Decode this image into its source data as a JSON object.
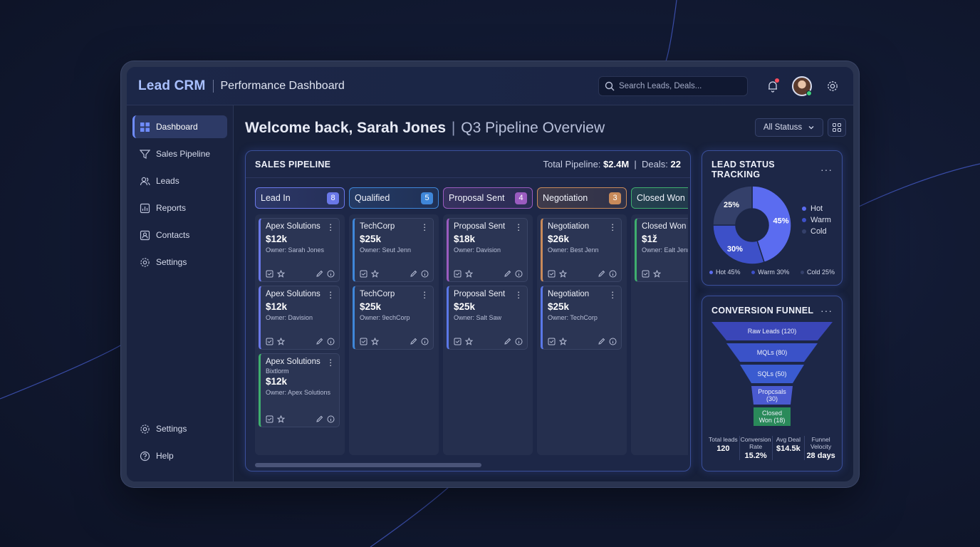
{
  "app": {
    "brand": "Lead CRM",
    "subtitle": "Performance Dashboard"
  },
  "search": {
    "placeholder": "Search Leads, Deals..."
  },
  "sidebar": {
    "items": [
      {
        "label": "Dashboard",
        "icon": "dashboard-icon",
        "active": true
      },
      {
        "label": "Sales Pipeline",
        "icon": "filter-icon"
      },
      {
        "label": "Leads",
        "icon": "users-icon"
      },
      {
        "label": "Reports",
        "icon": "report-icon"
      },
      {
        "label": "Contacts",
        "icon": "contacts-icon"
      },
      {
        "label": "Settings",
        "icon": "gear-icon"
      }
    ],
    "bottom": [
      {
        "label": "Settings",
        "icon": "gear-icon"
      },
      {
        "label": "Help",
        "icon": "help-icon"
      }
    ]
  },
  "header": {
    "welcome": "Welcome back, Sarah Jones",
    "separator": "|",
    "overview": "Q3 Pipeline Overview",
    "status_filter": "All Statuss"
  },
  "pipeline": {
    "title": "SALES PIPELINE",
    "total_label": "Total Pipeline:",
    "total_value": "$2.4M",
    "divider": "|",
    "deals_label": "Deals:",
    "deals_value": "22",
    "columns": [
      {
        "name": "Lead In",
        "count": "8",
        "color": "#6a78e8",
        "cards": [
          {
            "title": "Apex Solutions",
            "amount": "$12k",
            "owner": "Owner: Sarah Jones"
          },
          {
            "title": "Apex Solutions",
            "amount": "$12k",
            "owner": "Owner: Davision"
          },
          {
            "title": "Apex Solutions",
            "sub": "Bixtlorm",
            "amount": "$12k",
            "owner": "Owner: Apex Solutions",
            "accent": "#3fae6e"
          }
        ]
      },
      {
        "name": "Qualified",
        "count": "5",
        "color": "#3f86d8",
        "cards": [
          {
            "title": "TechCorp",
            "amount": "$25k",
            "owner": "Owner: Seut Jenn"
          },
          {
            "title": "TechCorp",
            "amount": "$25k",
            "owner": "Owner: 9echCorp"
          }
        ]
      },
      {
        "name": "Proposal Sent",
        "count": "4",
        "color": "#9a5bbf",
        "cards": [
          {
            "title": "Proposal Sent",
            "amount": "$18k",
            "owner": "Owner: Davision"
          },
          {
            "title": "Proposal Sent",
            "amount": "$25k",
            "owner": "Owner: Salt Saw",
            "accent": "#5a78e8"
          }
        ]
      },
      {
        "name": "Negotiation",
        "count": "3",
        "color": "#c88a5a",
        "cards": [
          {
            "title": "Negotiation",
            "amount": "$26k",
            "owner": "Owner: Best Jenn"
          },
          {
            "title": "Negotiation",
            "amount": "$25k",
            "owner": "Owner: TechCorp",
            "accent": "#5a78e8"
          }
        ]
      },
      {
        "name": "Closed Won",
        "count": "",
        "color": "#3fae6e",
        "cards": [
          {
            "title": "Closed Won",
            "amount": "$1ž",
            "owner": "Owner: Ealt Jenn"
          }
        ]
      }
    ]
  },
  "lead_status": {
    "title": "LEAD STATUS TRACKING",
    "more": "···",
    "legend": [
      {
        "label": "Hot",
        "color": "#5b6cf0"
      },
      {
        "label": "Warm",
        "color": "#3d50c8"
      },
      {
        "label": "Cold",
        "color": "#34406a"
      }
    ],
    "summary": [
      {
        "label": "Hot 45%",
        "color": "#5b6cf0"
      },
      {
        "label": "Warm 30%",
        "color": "#3d50c8"
      },
      {
        "label": "Cold 25%",
        "color": "#34406a"
      }
    ],
    "labels": {
      "hot": "45%",
      "warm": "30%",
      "cold": "25%"
    }
  },
  "chart_data": {
    "type": "pie",
    "title": "LEAD STATUS TRACKING",
    "categories": [
      "Hot",
      "Warm",
      "Cold"
    ],
    "values": [
      45,
      30,
      25
    ],
    "legend": "right"
  },
  "funnel": {
    "title": "CONVERSION FUNNEL",
    "more": "···",
    "stages": [
      {
        "label": "Raw Leads (120)",
        "color": "#3a46b8"
      },
      {
        "label": "MQLs (80)",
        "color": "#3a52c8"
      },
      {
        "label": "SQLs (50)",
        "color": "#3a5bd0"
      },
      {
        "label": "Propcsals (30)",
        "color": "#4a5ad0"
      },
      {
        "label": "Closed Won (18)",
        "color": "#2a8a5a"
      }
    ],
    "stats": [
      {
        "label": "Total leads",
        "value": "120"
      },
      {
        "label": "Conversion Rate",
        "value": "15.2%"
      },
      {
        "label": "Avg Deal",
        "value": "$14.5k"
      },
      {
        "label": "Funnel Velocity",
        "value": "28 days"
      }
    ]
  }
}
